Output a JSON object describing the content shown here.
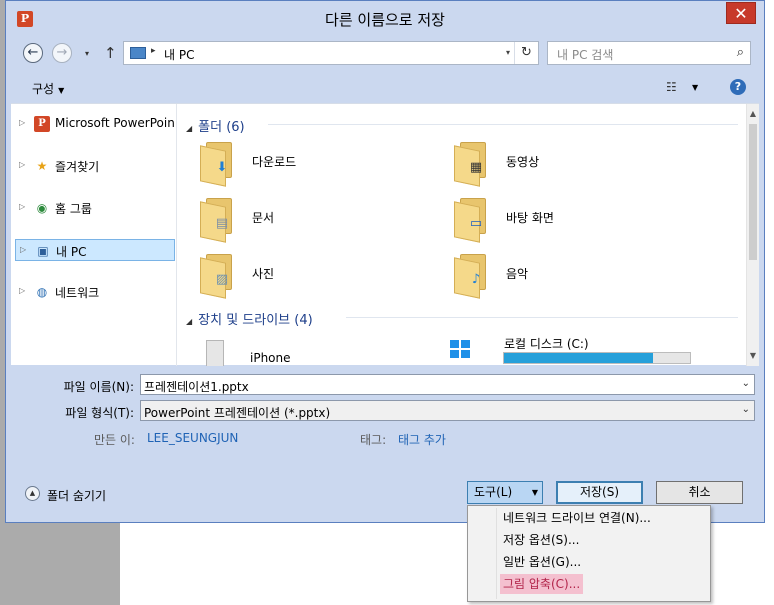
{
  "window": {
    "title": "다른 이름으로 저장",
    "app_icon_letter": "P",
    "close_symbol": "✕"
  },
  "nav": {
    "back_symbol": "←",
    "forward_symbol": "→",
    "recent_symbol": "▾",
    "up_symbol": "↑",
    "address_separator": "▸",
    "address_path": "내 PC",
    "address_dropdown": "▾",
    "refresh_symbol": "↻",
    "search_placeholder": "내 PC 검색",
    "search_symbol": "⌕"
  },
  "toolbar": {
    "organize_label": "구성",
    "organize_caret": "▼",
    "view_symbol": "☷",
    "view_caret": "▼",
    "help_symbol": "?"
  },
  "sidebar": {
    "expand_arrow": "▷",
    "items": [
      {
        "label": "Microsoft PowerPoint",
        "icon": "powerpoint-icon",
        "glyph": "P"
      },
      {
        "label": "즐겨찾기",
        "icon": "star-icon",
        "glyph": "★"
      },
      {
        "label": "홈 그룹",
        "icon": "homegroup-icon",
        "glyph": "◉"
      },
      {
        "label": "내 PC",
        "icon": "computer-icon",
        "glyph": "▣"
      },
      {
        "label": "네트워크",
        "icon": "network-icon",
        "glyph": "◍"
      }
    ]
  },
  "content": {
    "collapse_symbol": "◢",
    "folders_header": "폴더 (6)",
    "folders": [
      {
        "label": "다운로드",
        "badge": "⬇",
        "badge_color": "#1f7fd6"
      },
      {
        "label": "동영상",
        "badge": "▦",
        "badge_color": "#333333"
      },
      {
        "label": "문서",
        "badge": "▤",
        "badge_color": "#7a8da6"
      },
      {
        "label": "바탕 화면",
        "badge": "▭",
        "badge_color": "#1f5fbf"
      },
      {
        "label": "사진",
        "badge": "▨",
        "badge_color": "#6a8fb0"
      },
      {
        "label": "음악",
        "badge": "♪",
        "badge_color": "#1f7fd6"
      }
    ],
    "devices_header": "장치 및 드라이브 (4)",
    "devices": [
      {
        "label": "iPhone"
      },
      {
        "label": "로컬 디스크 (C:)",
        "used_fraction": 0.8
      }
    ],
    "scroll_up": "▲",
    "scroll_down": "▼"
  },
  "form": {
    "filename_label": "파일 이름(N):",
    "filename_value": "프레젠테이션1.pptx",
    "filetype_label": "파일 형식(T):",
    "filetype_value": "PowerPoint 프레젠테이션 (*.pptx)",
    "combo_caret": "⌄",
    "author_label": "만든 이:",
    "author_value": "LEE_SEUNGJUN",
    "tags_label": "태그:",
    "tags_value": "태그 추가"
  },
  "footer": {
    "hide_folders_label": "폴더 숨기기",
    "hide_symbol": "▲",
    "tools_label": "도구(L)",
    "tools_caret": "▼",
    "save_label": "저장(S)",
    "cancel_label": "취소"
  },
  "tools_menu": {
    "items": [
      "네트워크 드라이브 연결(N)...",
      "저장 옵션(S)...",
      "일반 옵션(G)...",
      "그림 압축(C)..."
    ]
  },
  "colors": {
    "dialog_bg": "#cbd8ef",
    "selected_bg": "#cce8ff",
    "link": "#1f63b5",
    "menu_highlight": "#f4c0cf"
  }
}
